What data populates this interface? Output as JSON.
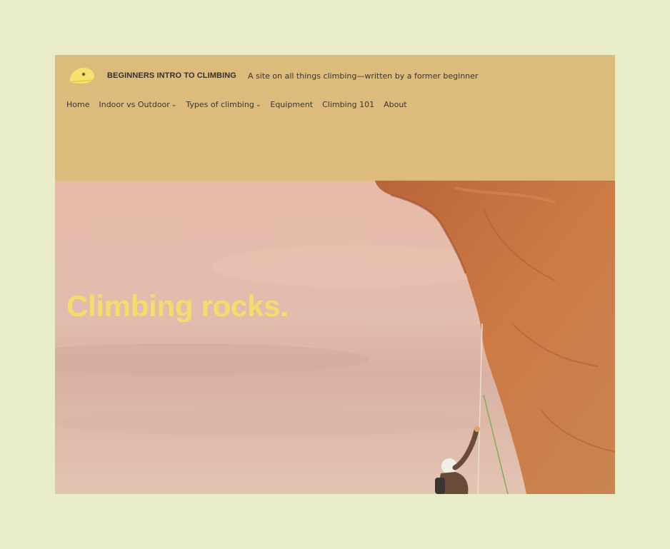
{
  "site": {
    "title": "BEGINNERS INTRO TO CLIMBING",
    "tagline": "A site on all things climbing—written by a former beginner",
    "logo_icon": "climbing-hold-icon"
  },
  "nav": {
    "home": "Home",
    "indoor_outdoor": "Indoor vs Outdoor",
    "types": "Types of climbing",
    "equipment": "Equipment",
    "climbing101": "Climbing 101",
    "about": "About",
    "dropdown_icon": "chevron-down-icon"
  },
  "hero": {
    "heading": "Climbing rocks."
  },
  "colors": {
    "page_bg": "#e8ecca",
    "header_bg": "#dcbb7d",
    "hero_sky": "#e4bcaa",
    "rock": "#c8703e",
    "heading": "#f7dc6c"
  }
}
